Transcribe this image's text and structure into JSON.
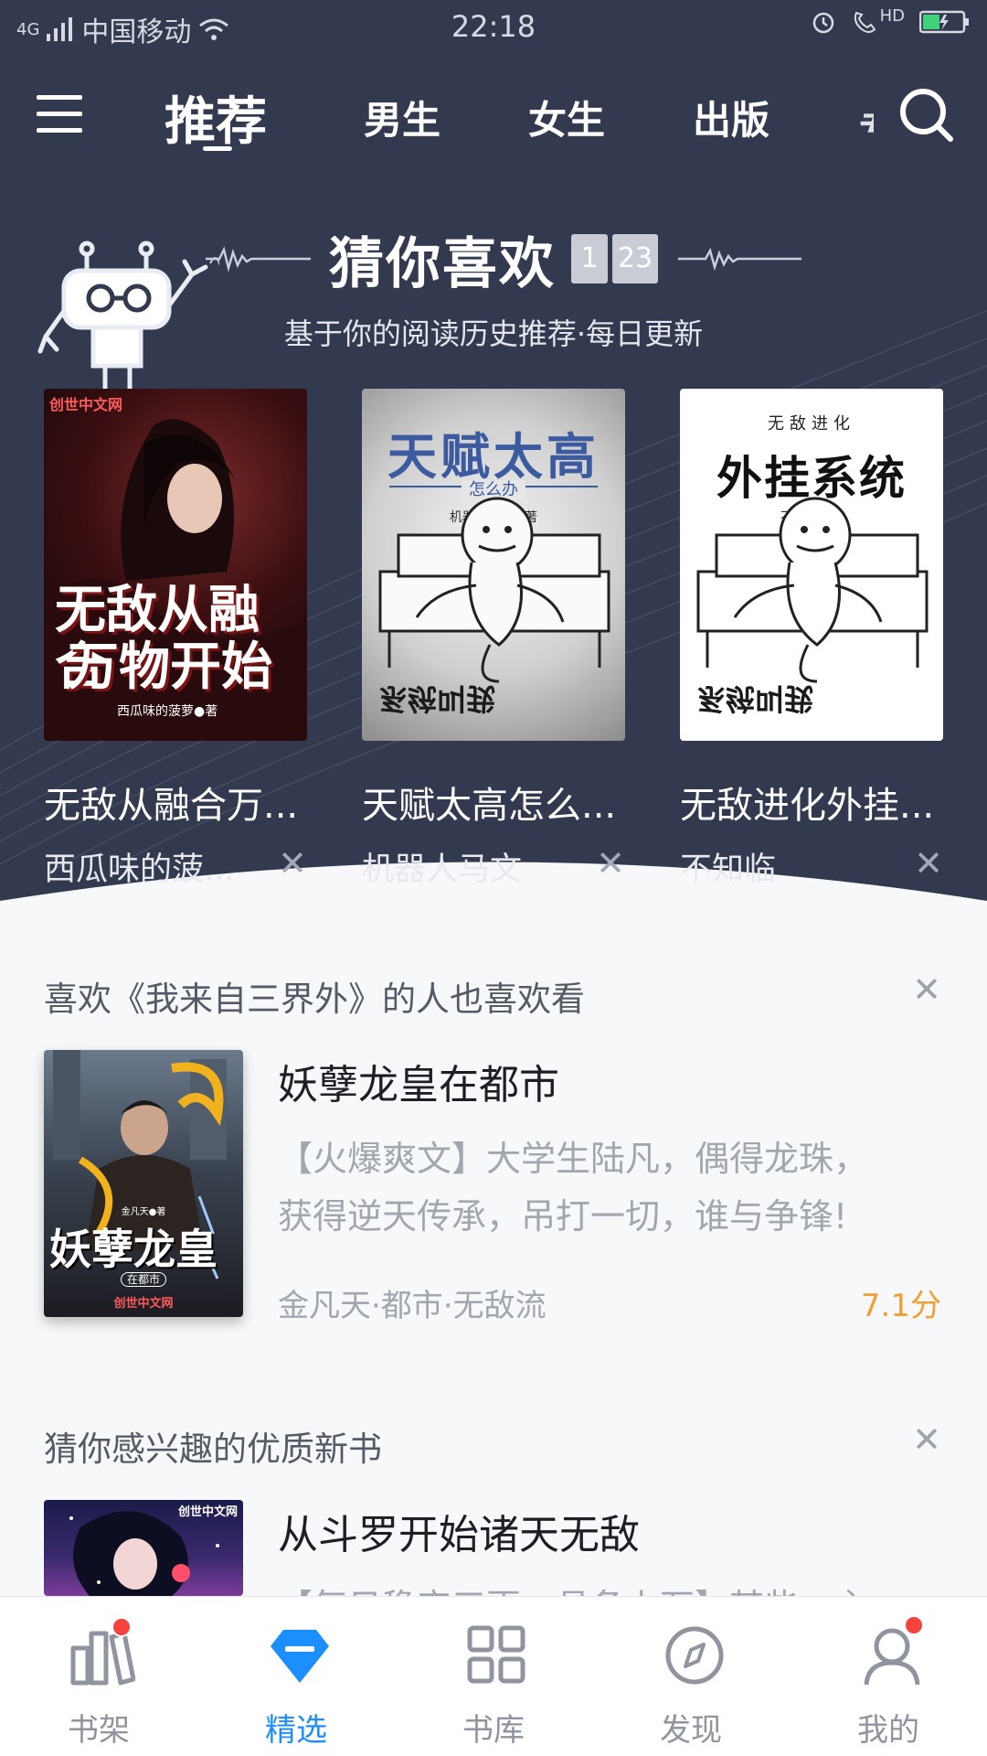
{
  "status_bar": {
    "network": "4G",
    "carrier": "中国移动",
    "time": "22:18",
    "hd": "HD"
  },
  "top_nav": {
    "tabs": [
      {
        "label": "推荐",
        "active": true
      },
      {
        "label": "男生",
        "active": false
      },
      {
        "label": "女生",
        "active": false
      },
      {
        "label": "出版",
        "active": false
      }
    ]
  },
  "guess": {
    "title": "猜你喜欢",
    "date_badge": [
      "1",
      "23"
    ],
    "subtitle": "基于你的阅读历史推荐·每日更新",
    "books": [
      {
        "title": "无敌从融合万...",
        "author": "西瓜味的菠...",
        "cover_text": [
          "无敌从融合",
          "万物开始"
        ],
        "cover_author": "西瓜味的菠萝●著",
        "cover_logo": "创世中文网"
      },
      {
        "title": "天赋太高怎么...",
        "author": "机器人马文",
        "cover_text": [
          "天赋太高"
        ],
        "cover_sub": "怎么办",
        "cover_author": "机器人马文●著"
      },
      {
        "title": "无敌进化外挂...",
        "author": "不知临",
        "cover_text": [
          "外挂系统"
        ],
        "cover_sub": "无敌进化",
        "cover_author": "不知临●著"
      }
    ]
  },
  "sections": [
    {
      "title": "喜欢《我来自三界外》的人也喜欢看",
      "book": {
        "title": "妖孽龙皇在都市",
        "desc_line1": "【火爆爽文】大学生陆凡，偶得龙珠，",
        "desc_line2": "获得逆天传承，吊打一切，谁与争锋!",
        "meta": "金凡天·都市·无敌流",
        "score": "7.1分",
        "cover_text": "妖孽龙皇",
        "cover_sub": "在都市",
        "cover_author": "金凡天●著",
        "cover_logo": "创世中文网"
      }
    },
    {
      "title": "猜你感兴趣的优质新书",
      "book": {
        "title": "从斗罗开始诸天无敌",
        "desc_line1": "【每日稳定三更，具备上万】某些、主",
        "cover_logo": "创世中文网"
      }
    }
  ],
  "bottom_tabs": [
    {
      "label": "书架",
      "icon": "bookshelf-icon",
      "badge": true,
      "active": false
    },
    {
      "label": "精选",
      "icon": "diamond-icon",
      "badge": false,
      "active": true
    },
    {
      "label": "书库",
      "icon": "grid-icon",
      "badge": false,
      "active": false
    },
    {
      "label": "发现",
      "icon": "compass-icon",
      "badge": false,
      "active": false
    },
    {
      "label": "我的",
      "icon": "user-icon",
      "badge": true,
      "active": false
    }
  ],
  "colors": {
    "hero_bg": "#333a4f",
    "accent": "#1c8fff",
    "score": "#f0a030",
    "badge": "#f4433f"
  }
}
